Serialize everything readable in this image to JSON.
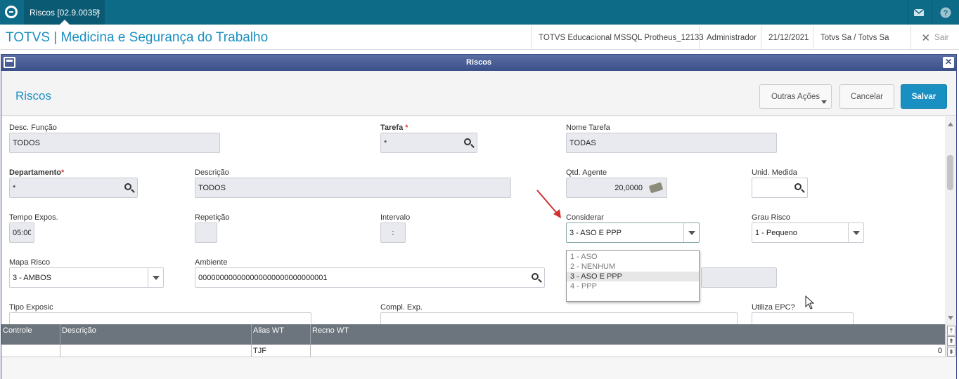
{
  "topbar": {
    "tab_label": "Riscos [02.9.0035]",
    "tab_close": "×",
    "icons": [
      "totvs-logo-icon",
      "mail-icon",
      "help-icon"
    ]
  },
  "header": {
    "app_title": "TOTVS | Medicina e Segurança do Trabalho",
    "environment": "TOTVS Educacional MSSQL Protheus_12133",
    "user": "Administrador",
    "date": "21/12/2021",
    "company": "Totvs Sa / Totvs Sa",
    "exit_label": "Sair"
  },
  "dialog": {
    "title": "Riscos",
    "form_title": "Riscos",
    "buttons": {
      "outras_acoes": "Outras Ações",
      "cancelar": "Cancelar",
      "salvar": "Salvar"
    }
  },
  "form": {
    "desc_funcao": {
      "label": "Desc. Função",
      "value": "TODOS"
    },
    "tarefa": {
      "label": "Tarefa",
      "required": "*",
      "value": "*"
    },
    "nome_tarefa": {
      "label": "Nome Tarefa",
      "value": "TODAS"
    },
    "departamento": {
      "label": "Departamento",
      "required": "*",
      "value": "*"
    },
    "descricao": {
      "label": "Descrição",
      "value": "TODOS"
    },
    "qtd_agente": {
      "label": "Qtd. Agente",
      "value": "20,0000"
    },
    "unid_medida": {
      "label": "Unid. Medida",
      "value": ""
    },
    "tempo_expos": {
      "label": "Tempo Expos.",
      "value": "05:00"
    },
    "repeticao": {
      "label": "Repetição",
      "value": ""
    },
    "intervalo": {
      "label": "Intervalo",
      "value": ":"
    },
    "considerar": {
      "label": "Considerar",
      "value": "3 - ASO E PPP",
      "options": [
        "1 - ASO",
        "2 - NENHUM",
        "3 - ASO E PPP",
        "4 - PPP"
      ]
    },
    "grau_risco": {
      "label": "Grau Risco",
      "value": "1 - Pequeno"
    },
    "mapa_risco": {
      "label": "Mapa Risco",
      "value": "3 - AMBOS"
    },
    "ambiente": {
      "label": "Ambiente",
      "value": "000000000000000000000000000001"
    },
    "tipo_exposic": {
      "label": "Tipo Exposic"
    },
    "compl_exp": {
      "label": "Compl. Exp."
    },
    "utiliza_epc": {
      "label": "Utiliza EPC?"
    }
  },
  "grid": {
    "columns": [
      "Controle",
      "Descrição",
      "Alias WT",
      "Recno WT"
    ],
    "rows": [
      {
        "controle": "",
        "descricao": "",
        "alias_wt": "TJF",
        "recno_wt": "0"
      }
    ]
  },
  "colors": {
    "topbar": "#0e6b88",
    "accent": "#1a8fc1",
    "dialog_header": "#3b4f89",
    "grid_header": "#6c757d",
    "required": "#e53935",
    "annotation_arrow": "#d32f2f"
  }
}
